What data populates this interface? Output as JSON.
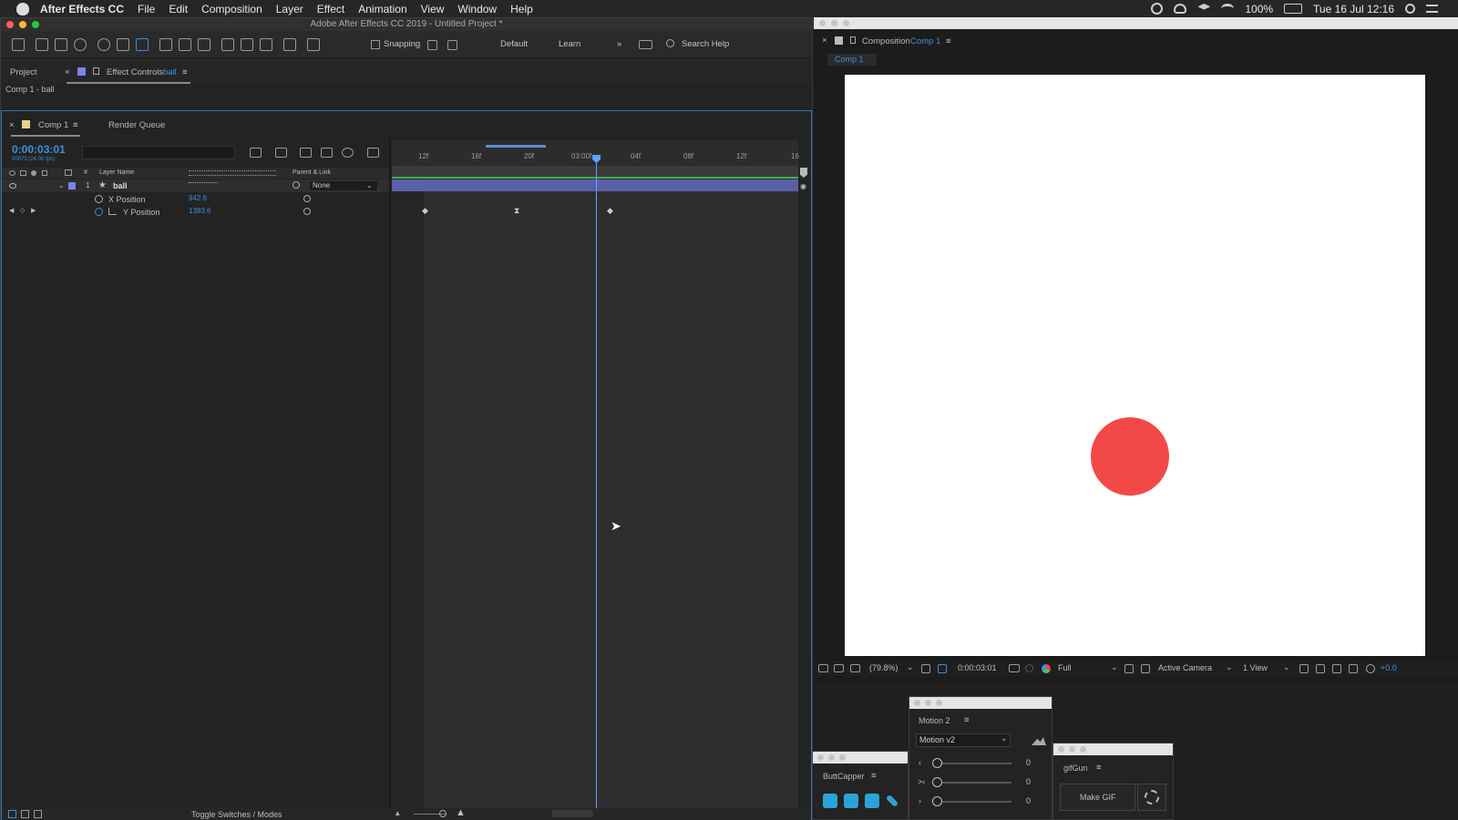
{
  "menubar": {
    "app_name": "After Effects CC",
    "menus": [
      "File",
      "Edit",
      "Composition",
      "Layer",
      "Effect",
      "Animation",
      "View",
      "Window",
      "Help"
    ],
    "battery": "100%",
    "datetime": "Tue 16 Jul  12:16"
  },
  "window": {
    "title": "Adobe After Effects CC 2019 - Untitled Project *"
  },
  "toolbar": {
    "snapping_label": "Snapping",
    "workspace_default": "Default",
    "workspace_learn": "Learn",
    "search_placeholder": "Search Help"
  },
  "project_panel": {
    "tab_project": "Project",
    "tab_effect_controls_prefix": "Effect Controls",
    "tab_effect_controls_layer": "ball",
    "breadcrumb": "Comp 1 - ball"
  },
  "timeline": {
    "tab_comp": "Comp 1",
    "tab_render_queue": "Render Queue",
    "timecode": "0:00:03:01",
    "fps_sub": "00073 (24.00 fps)",
    "col_layer_name": "Layer Name",
    "col_parent": "Parent & Link",
    "col_hash": "#",
    "ruler_ticks": [
      "12f",
      "16f",
      "20f",
      "03:00f",
      "04f",
      "08f",
      "12f",
      "16"
    ],
    "layer": {
      "index": "1",
      "name": "ball",
      "parent": "None",
      "color": "#7b83e8"
    },
    "props": [
      {
        "name": "X Position",
        "value": "942.6"
      },
      {
        "name": "Y Position",
        "value": "1383.6"
      }
    ],
    "toggle_label": "Toggle Switches / Modes"
  },
  "composition": {
    "panel_prefix": "Composition",
    "panel_comp": "Comp 1",
    "subtab": "Comp 1",
    "ball_color": "#f34848",
    "zoom": "(79.8%)",
    "timecode": "0:00:03:01",
    "resolution": "Full",
    "camera": "Active Camera",
    "views": "1 View",
    "exposure": "+0.0"
  },
  "motion_panel": {
    "title": "Motion 2",
    "dropdown": "Motion v2",
    "values": [
      "0",
      "0",
      "0"
    ]
  },
  "buttcapper_panel": {
    "title": "ButtCapper"
  },
  "gifgun_panel": {
    "title": "gifGun",
    "button": "Make GIF"
  }
}
